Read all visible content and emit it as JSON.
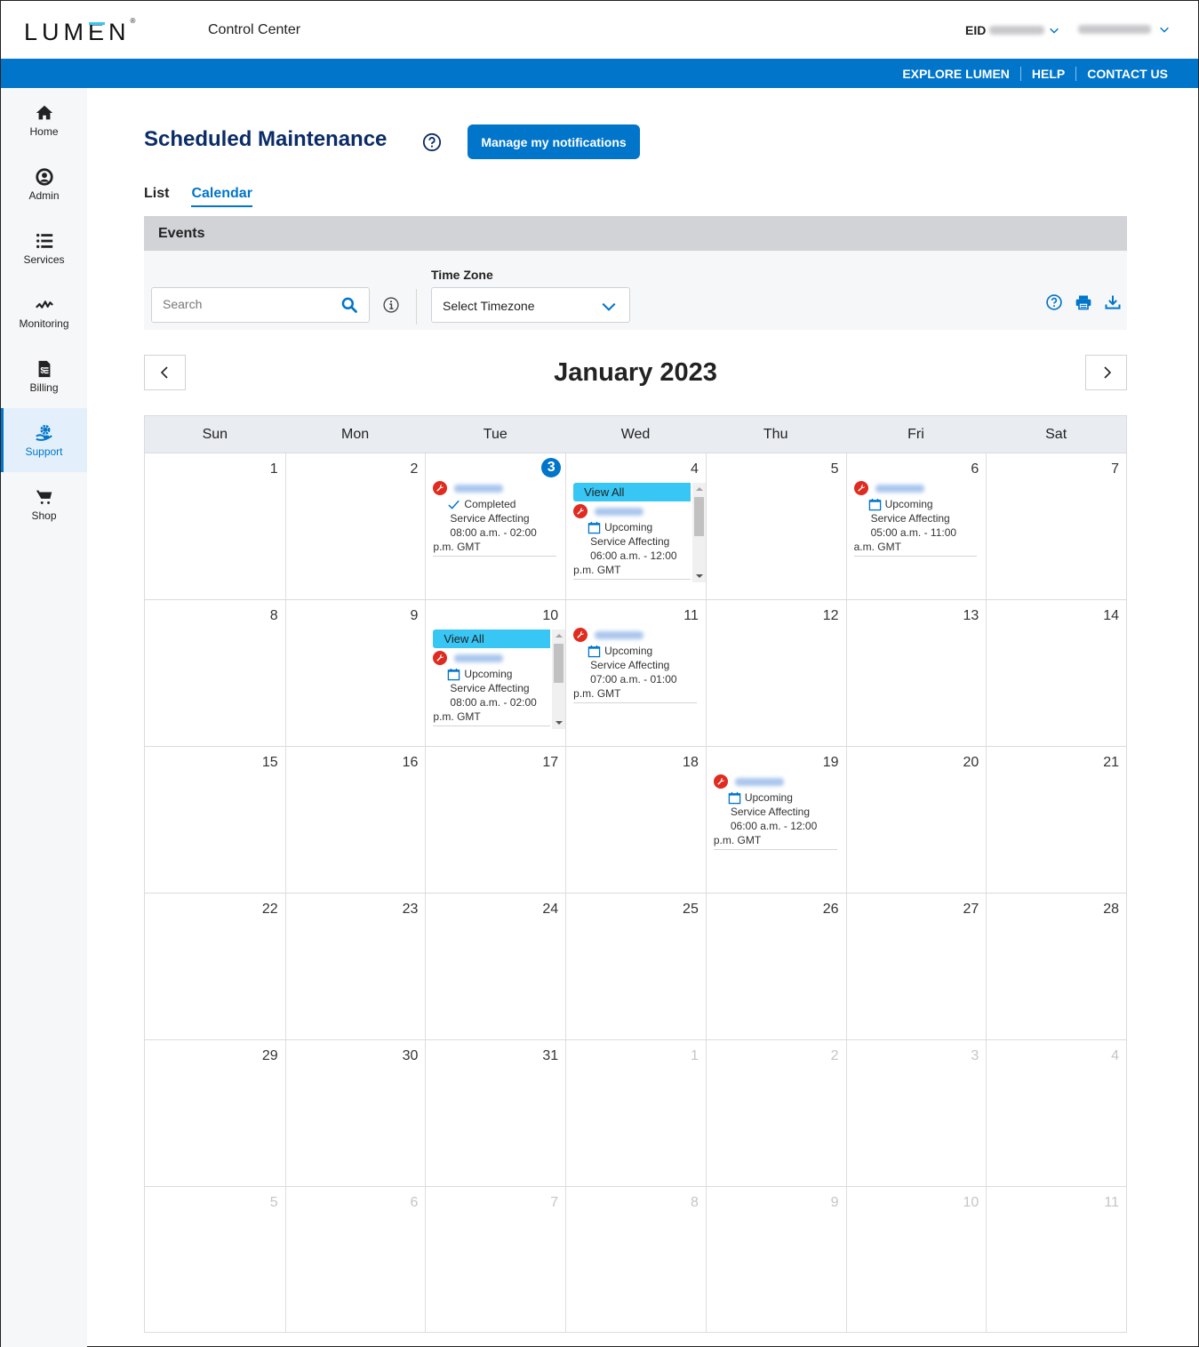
{
  "header": {
    "logo": "LUMEN",
    "app_title": "Control Center",
    "eid_label": "EID",
    "links": [
      "EXPLORE LUMEN",
      "HELP",
      "CONTACT US"
    ]
  },
  "sidebar": {
    "items": [
      {
        "label": "Home",
        "icon": "home-icon"
      },
      {
        "label": "Admin",
        "icon": "user-circle-icon"
      },
      {
        "label": "Services",
        "icon": "list-icon"
      },
      {
        "label": "Monitoring",
        "icon": "pulse-icon"
      },
      {
        "label": "Billing",
        "icon": "invoice-icon"
      },
      {
        "label": "Support",
        "icon": "support-hand-gear-icon",
        "active": true
      },
      {
        "label": "Shop",
        "icon": "cart-icon"
      }
    ]
  },
  "page": {
    "title": "Scheduled Maintenance",
    "manage_button": "Manage my notifications",
    "tabs": [
      {
        "label": "List"
      },
      {
        "label": "Calendar",
        "active": true
      }
    ]
  },
  "filters": {
    "section_title": "Events",
    "search_placeholder": "Search",
    "timezone_label": "Time Zone",
    "timezone_value": "Select Timezone"
  },
  "calendar": {
    "month_title": "January 2023",
    "today": 3,
    "weekdays": [
      "Sun",
      "Mon",
      "Tue",
      "Wed",
      "Thu",
      "Fri",
      "Sat"
    ],
    "view_all_label": "View All",
    "weeks": [
      [
        {
          "d": "1"
        },
        {
          "d": "2"
        },
        {
          "d": "3"
        },
        {
          "d": "4"
        },
        {
          "d": "5"
        },
        {
          "d": "6"
        },
        {
          "d": "7"
        }
      ],
      [
        {
          "d": "8"
        },
        {
          "d": "9"
        },
        {
          "d": "10"
        },
        {
          "d": "11"
        },
        {
          "d": "12"
        },
        {
          "d": "13"
        },
        {
          "d": "14"
        }
      ],
      [
        {
          "d": "15"
        },
        {
          "d": "16"
        },
        {
          "d": "17"
        },
        {
          "d": "18"
        },
        {
          "d": "19"
        },
        {
          "d": "20"
        },
        {
          "d": "21"
        }
      ],
      [
        {
          "d": "22"
        },
        {
          "d": "23"
        },
        {
          "d": "24"
        },
        {
          "d": "25"
        },
        {
          "d": "26"
        },
        {
          "d": "27"
        },
        {
          "d": "28"
        }
      ],
      [
        {
          "d": "29"
        },
        {
          "d": "30"
        },
        {
          "d": "31"
        },
        {
          "d": "1",
          "other": true
        },
        {
          "d": "2",
          "other": true
        },
        {
          "d": "3",
          "other": true
        },
        {
          "d": "4",
          "other": true
        }
      ],
      [
        {
          "d": "5",
          "other": true
        },
        {
          "d": "6",
          "other": true
        },
        {
          "d": "7",
          "other": true
        },
        {
          "d": "8",
          "other": true
        },
        {
          "d": "9",
          "other": true
        },
        {
          "d": "10",
          "other": true
        },
        {
          "d": "11",
          "other": true
        }
      ]
    ],
    "events": {
      "w0d2": {
        "status": "Completed",
        "type": "Service Affecting",
        "time1": "08:00 a.m. - 02:00",
        "time2": "p.m. GMT"
      },
      "w0d3": {
        "status": "Upcoming",
        "type": "Service Affecting",
        "time1": "06:00 a.m. - 12:00",
        "time2": "p.m. GMT",
        "view_all": true
      },
      "w0d5": {
        "status": "Upcoming",
        "type": "Service Affecting",
        "time1": "05:00 a.m. - 11:00",
        "time2": "a.m. GMT"
      },
      "w1d2": {
        "status": "Upcoming",
        "type": "Service Affecting",
        "time1": "08:00 a.m. - 02:00",
        "time2": "p.m. GMT",
        "view_all": true
      },
      "w1d3": {
        "status": "Upcoming",
        "type": "Service Affecting",
        "time1": "07:00 a.m. - 01:00",
        "time2": "p.m. GMT"
      },
      "w2d4": {
        "status": "Upcoming",
        "type": "Service Affecting",
        "time1": "06:00 a.m. - 12:00",
        "time2": "p.m. GMT"
      }
    }
  },
  "colors": {
    "brand_blue": "#0075c9",
    "title_navy": "#0b2c67",
    "view_all_cyan": "#38c6f4",
    "maintenance_red": "#e02b20"
  }
}
